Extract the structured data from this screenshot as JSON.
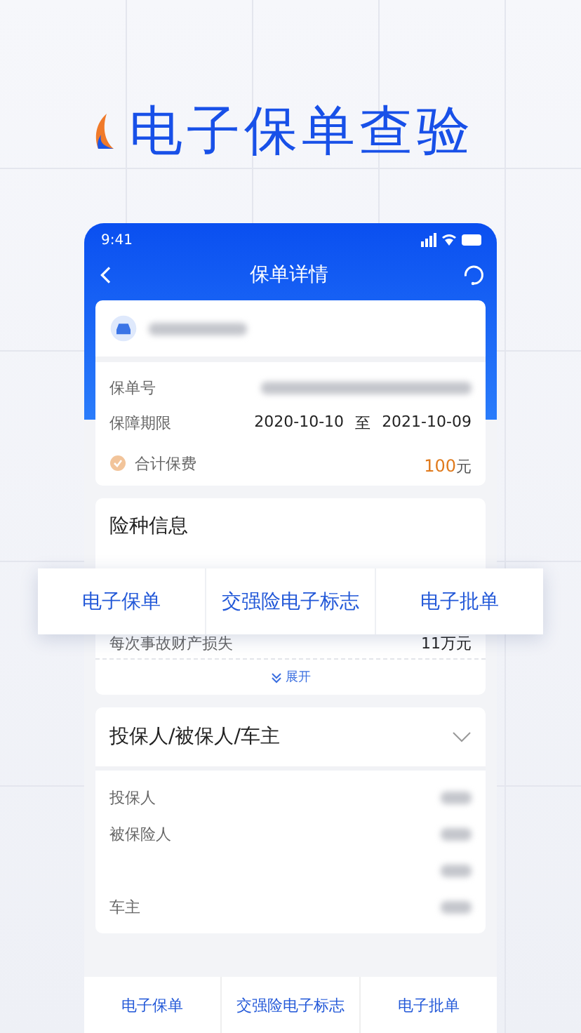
{
  "headline": "电子保单查验",
  "phone": {
    "status_bar": {
      "time": "9:41"
    },
    "nav": {
      "title": "保单详情"
    },
    "policy_card": {
      "rows": [
        {
          "kind": "redacted",
          "label": "保单号"
        },
        {
          "kind": "period",
          "label": "保障期限",
          "start": "2020-10-10",
          "separator": "至",
          "end": "2021-10-09"
        }
      ],
      "total": {
        "label": "合计保费",
        "amount": "100",
        "unit": "元"
      }
    },
    "coverage_card": {
      "title": "险种信息",
      "rows": [
        {
          "label": "每次事故财产损失",
          "value": "11万元"
        }
      ],
      "expand": "展开"
    },
    "parties_card": {
      "title": "投保人/被保人/车主",
      "rows": [
        {
          "label": "投保人"
        },
        {
          "label": "被保险人"
        },
        {
          "label": ""
        },
        {
          "label": "车主"
        }
      ]
    },
    "bottom_tabs": [
      "电子保单",
      "交强险电子标志",
      "电子批单"
    ]
  },
  "floating_tabs": [
    "电子保单",
    "交强险电子标志",
    "电子批单"
  ]
}
